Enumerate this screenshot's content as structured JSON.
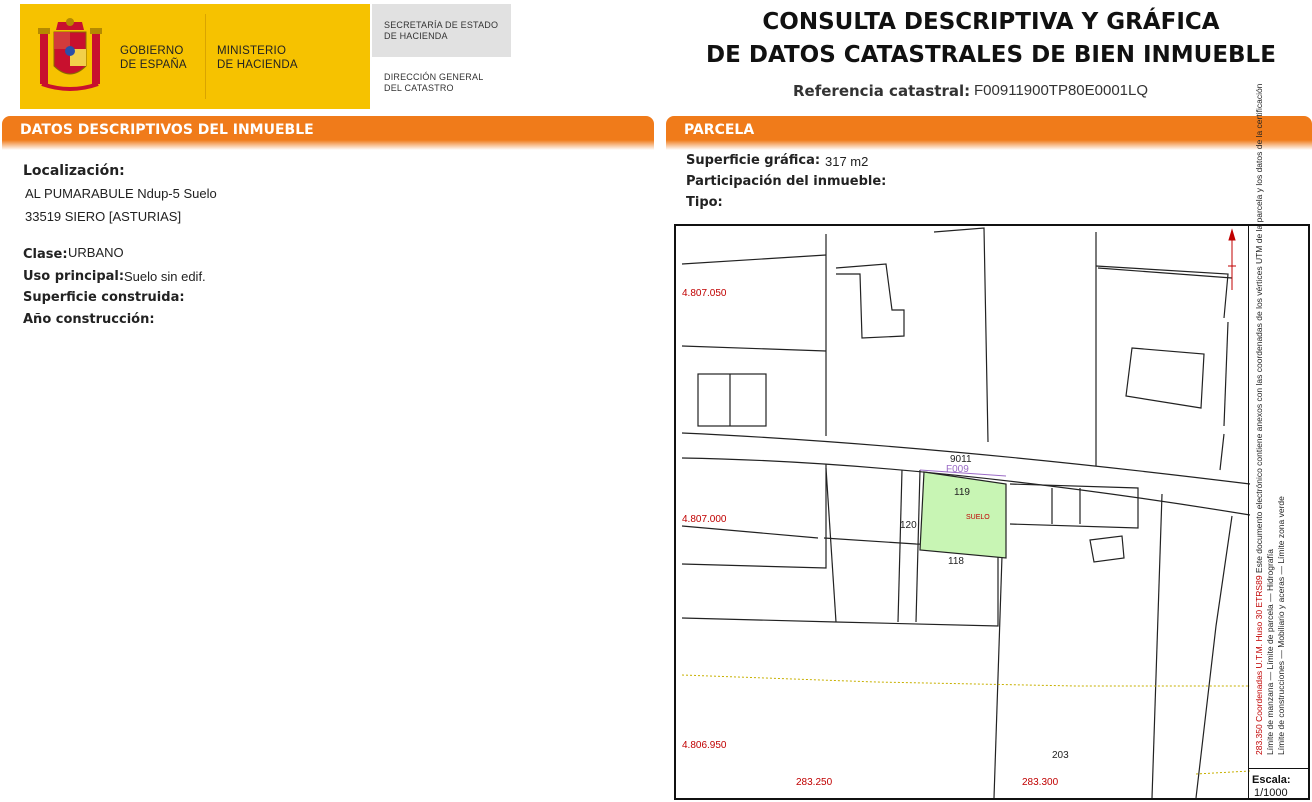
{
  "header": {
    "gov_line1": "GOBIERNO",
    "gov_line2": "DE ESPAÑA",
    "ministry_line1": "MINISTERIO",
    "ministry_line2": "DE HACIENDA",
    "secretaria_line1": "SECRETARÍA DE ESTADO",
    "secretaria_line2": "DE HACIENDA",
    "direccion_line1": "DIRECCIÓN GENERAL",
    "direccion_line2": "DEL CATASTRO",
    "title_line1": "CONSULTA DESCRIPTIVA Y GRÁFICA",
    "title_line2": "DE DATOS CATASTRALES DE BIEN INMUEBLE",
    "ref_label": "Referencia catastral:",
    "ref_value": "F00911900TP80E0001LQ",
    "brand_color": "#f6c200"
  },
  "left_section": {
    "title": "DATOS DESCRIPTIVOS DEL INMUEBLE",
    "localizacion_label": "Localización:",
    "localizacion_line1": "AL PUMARABULE Ndup-5 Suelo",
    "localizacion_line2": "33519 SIERO [ASTURIAS]",
    "clase_label": "Clase:",
    "clase_value": "URBANO",
    "uso_label": "Uso principal:",
    "uso_value": "Suelo sin edif.",
    "superficie_label": "Superficie construida:",
    "anio_label": "Año construcción:",
    "accent_color": "#f07b1a"
  },
  "right_section": {
    "title": "PARCELA",
    "superficie_label": "Superficie gráfica:",
    "superficie_value": "317 m2",
    "participacion_label": "Participación del inmueble:",
    "tipo_label": "Tipo:"
  },
  "map": {
    "northing_labels": [
      "4.807.050",
      "4.807.000",
      "4.806.950"
    ],
    "easting_labels": [
      "283.250",
      "283.300"
    ],
    "parcel_labels": {
      "road": "9011",
      "block": "F009",
      "p119": "119",
      "suelo": "SUELO",
      "p120": "120",
      "p118": "118",
      "p203": "203"
    },
    "parcel_fill": "#c8f5b4",
    "coordinate_color": "#c00000",
    "legend": {
      "line1_red": "283.350 Coordenadas U.T.M. Huso 30 ETRS89",
      "line1_rest": "Este documento electrónico contiene anexos con las coordenadas de los vértices UTM de la parcela y los datos de la certificación",
      "line2": "Límite de manzana — Límite de parcela — Hidrografía",
      "line3": "Límite de construcciones — Mobiliario y aceras — Límite zona verde"
    },
    "scale_label": "Escala:",
    "scale_value": "1/1000"
  }
}
